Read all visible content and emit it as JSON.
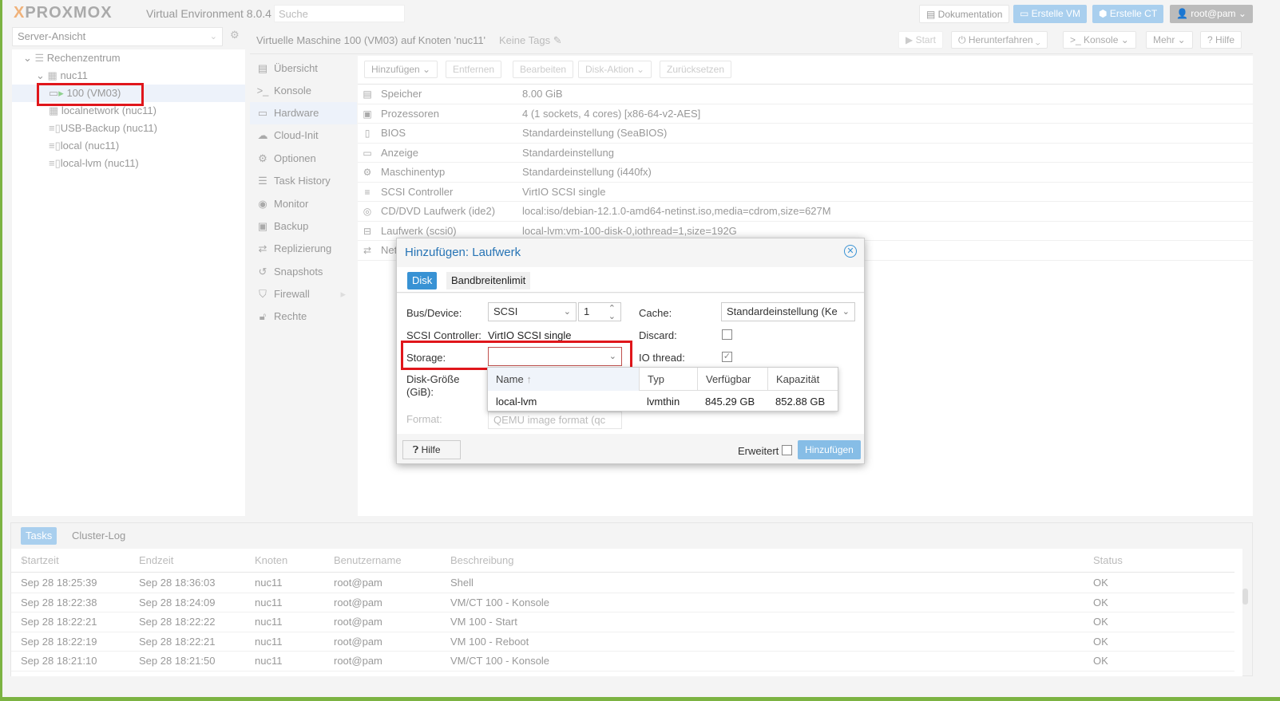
{
  "header": {
    "logo": "PROXMOX",
    "product": "Virtual Environment 8.0.4",
    "search_placeholder": "Suche",
    "doc": "Dokumentation",
    "create_vm": "Erstelle VM",
    "create_ct": "Erstelle CT",
    "user": "root@pam"
  },
  "view_selector": "Server-Ansicht",
  "tree": [
    {
      "label": "Rechenzentrum",
      "icon": "datacenter-icon"
    },
    {
      "label": "nuc11",
      "icon": "node-icon"
    },
    {
      "label": "100 (VM03)",
      "icon": "vm-running-icon",
      "selected": true
    },
    {
      "label": "localnetwork (nuc11)",
      "icon": "network-icon"
    },
    {
      "label": "USB-Backup (nuc11)",
      "icon": "storage-icon"
    },
    {
      "label": "local (nuc11)",
      "icon": "storage-icon"
    },
    {
      "label": "local-lvm (nuc11)",
      "icon": "storage-icon"
    }
  ],
  "content": {
    "title": "Virtuelle Maschine 100 (VM03) auf Knoten 'nuc11'",
    "tags": "Keine Tags",
    "actions": {
      "start": "Start",
      "shutdown": "Herunterfahren",
      "console": "Konsole",
      "more": "Mehr",
      "help": "Hilfe"
    }
  },
  "nav": [
    {
      "label": "Übersicht",
      "icon": "book-icon"
    },
    {
      "label": "Konsole",
      "icon": "terminal-icon"
    },
    {
      "label": "Hardware",
      "icon": "monitor-icon",
      "active": true
    },
    {
      "label": "Cloud-Init",
      "icon": "cloud-icon"
    },
    {
      "label": "Optionen",
      "icon": "gear-icon"
    },
    {
      "label": "Task History",
      "icon": "list-icon"
    },
    {
      "label": "Monitor",
      "icon": "eye-icon"
    },
    {
      "label": "Backup",
      "icon": "floppy-icon"
    },
    {
      "label": "Replizierung",
      "icon": "retweet-icon"
    },
    {
      "label": "Snapshots",
      "icon": "history-icon"
    },
    {
      "label": "Firewall",
      "icon": "shield-icon"
    },
    {
      "label": "Rechte",
      "icon": "unlock-icon"
    }
  ],
  "hw_toolbar": {
    "add": "Hinzufügen",
    "remove": "Entfernen",
    "edit": "Bearbeiten",
    "disk_action": "Disk-Aktion",
    "reset": "Zurücksetzen"
  },
  "hardware": [
    {
      "key": "Speicher",
      "value": "8.00 GiB",
      "icon": "memory-icon"
    },
    {
      "key": "Prozessoren",
      "value": "4 (1 sockets, 4 cores) [x86-64-v2-AES]",
      "icon": "cpu-icon"
    },
    {
      "key": "BIOS",
      "value": "Standardeinstellung (SeaBIOS)",
      "icon": "microchip-icon"
    },
    {
      "key": "Anzeige",
      "value": "Standardeinstellung",
      "icon": "desktop-icon"
    },
    {
      "key": "Maschinentyp",
      "value": "Standardeinstellung (i440fx)",
      "icon": "cogs-icon"
    },
    {
      "key": "SCSI Controller",
      "value": "VirtIO SCSI single",
      "icon": "database-icon"
    },
    {
      "key": "CD/DVD Laufwerk (ide2)",
      "value": "local:iso/debian-12.1.0-amd64-netinst.iso,media=cdrom,size=627M",
      "icon": "cdrom-icon"
    },
    {
      "key": "Laufwerk (scsi0)",
      "value": "local-lvm:vm-100-disk-0,iothread=1,size=192G",
      "icon": "hdd-icon"
    },
    {
      "key": "Net",
      "value": "",
      "icon": "exchange-icon"
    }
  ],
  "dialog": {
    "title": "Hinzufügen: Laufwerk",
    "tabs": [
      "Disk",
      "Bandbreitenlimit"
    ],
    "bus_label": "Bus/Device:",
    "bus_value": "SCSI",
    "device_value": "1",
    "controller_label": "SCSI Controller:",
    "controller_value": "VirtIO SCSI single",
    "storage_label": "Storage:",
    "storage_value": "",
    "size_label": "Disk-Größe (GiB):",
    "format_label": "Format:",
    "format_value": "QEMU image format (qc",
    "cache_label": "Cache:",
    "cache_value": "Standardeinstellung (Ke",
    "discard_label": "Discard:",
    "discard_checked": false,
    "iothread_label": "IO thread:",
    "iothread_checked": true,
    "help": "Hilfe",
    "advanced": "Erweitert",
    "advanced_checked": false,
    "submit": "Hinzufügen",
    "storage_dropdown": {
      "columns": [
        "Name",
        "Typ",
        "Verfügbar",
        "Kapazität"
      ],
      "rows": [
        [
          "local-lvm",
          "lvmthin",
          "845.29 GB",
          "852.88 GB"
        ]
      ]
    }
  },
  "tasks": {
    "tabs": [
      "Tasks",
      "Cluster-Log"
    ],
    "columns": [
      "Startzeit",
      "Endzeit",
      "Knoten",
      "Benutzername",
      "Beschreibung",
      "Status"
    ],
    "rows": [
      [
        "Sep 28 18:25:39",
        "Sep 28 18:36:03",
        "nuc11",
        "root@pam",
        "Shell",
        "OK"
      ],
      [
        "Sep 28 18:22:38",
        "Sep 28 18:24:09",
        "nuc11",
        "root@pam",
        "VM/CT 100 - Konsole",
        "OK"
      ],
      [
        "Sep 28 18:22:21",
        "Sep 28 18:22:22",
        "nuc11",
        "root@pam",
        "VM 100 - Start",
        "OK"
      ],
      [
        "Sep 28 18:22:19",
        "Sep 28 18:22:21",
        "nuc11",
        "root@pam",
        "VM 100 - Reboot",
        "OK"
      ],
      [
        "Sep 28 18:21:10",
        "Sep 28 18:21:50",
        "nuc11",
        "root@pam",
        "VM/CT 100 - Konsole",
        "OK"
      ]
    ]
  },
  "colors": {
    "accent": "#3892d4",
    "highlight": "#e0161b",
    "logo_orange": "#e57000"
  }
}
